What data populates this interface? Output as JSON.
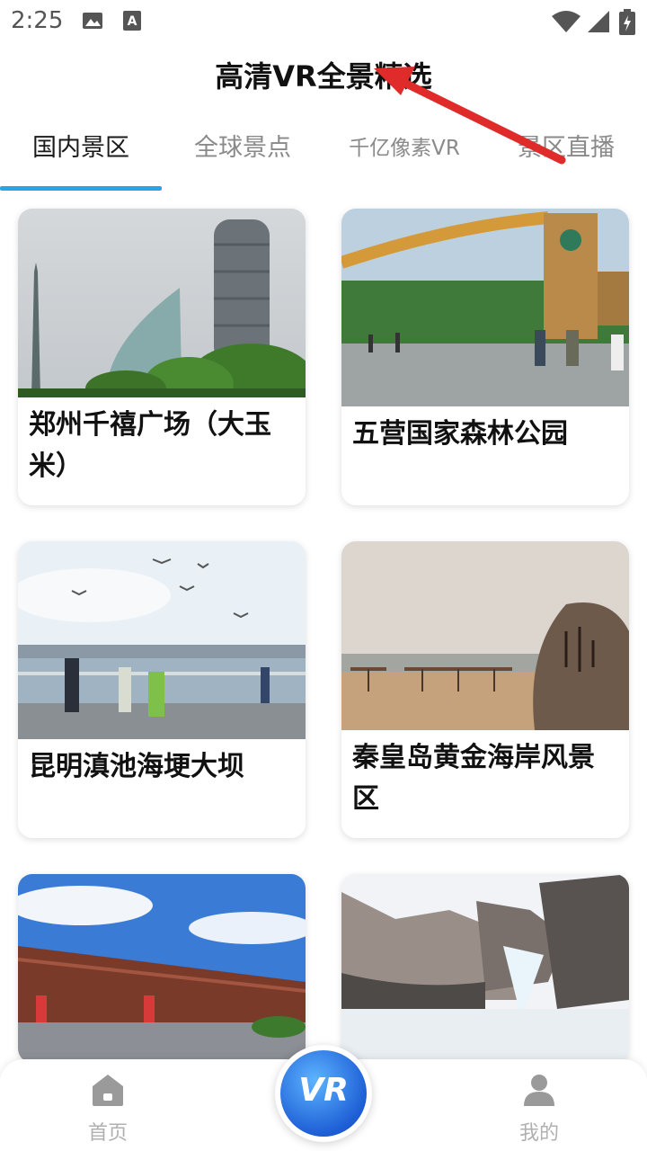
{
  "status_bar": {
    "time": "2:25",
    "icons": [
      "image-icon",
      "accessibility-a-icon",
      "wifi-icon",
      "signal-icon",
      "battery-charging-icon"
    ]
  },
  "header": {
    "title": "高清VR全景精选"
  },
  "tabs": [
    {
      "label": "国内景区",
      "active": true
    },
    {
      "label": "全球景点",
      "active": false
    },
    {
      "label": "千亿像素VR",
      "active": false
    },
    {
      "label": "景区直播",
      "active": false
    }
  ],
  "accent_color": "#29a3e3",
  "cards": [
    {
      "title": "郑州千禧广场（大玉米）"
    },
    {
      "title": "五营国家森林公园"
    },
    {
      "title": "昆明滇池海埂大坝"
    },
    {
      "title": "秦皇岛黄金海岸风景区"
    },
    {
      "title": ""
    },
    {
      "title": ""
    }
  ],
  "bottom_nav": {
    "home_label": "首页",
    "center_label": "VR",
    "mine_label": "我的"
  },
  "annotation": {
    "arrow_color": "#e02b2b"
  }
}
